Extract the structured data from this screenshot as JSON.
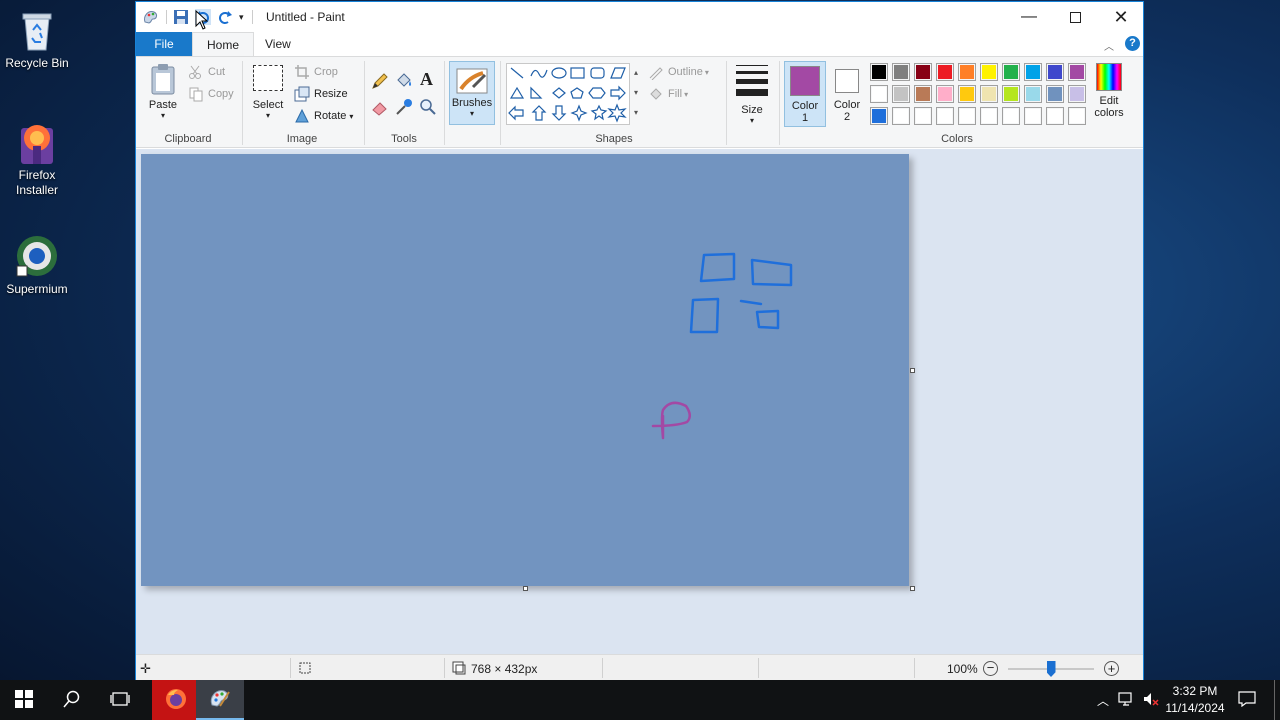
{
  "desktop": {
    "icons": [
      {
        "label": "Recycle Bin",
        "icon": "recycle-bin-icon"
      },
      {
        "label": "Firefox Installer",
        "icon": "firefox-installer-icon"
      },
      {
        "label": "Supermium",
        "icon": "supermium-icon"
      }
    ]
  },
  "window": {
    "title": "Untitled - Paint",
    "tabs": [
      {
        "label": "File"
      },
      {
        "label": "Home"
      },
      {
        "label": "View"
      }
    ],
    "ribbon": {
      "clipboard": {
        "group": "Clipboard",
        "paste": "Paste",
        "cut": "Cut",
        "copy": "Copy"
      },
      "image": {
        "group": "Image",
        "select": "Select",
        "crop": "Crop",
        "resize": "Resize",
        "rotate": "Rotate"
      },
      "tools": {
        "group": "Tools"
      },
      "brushes": {
        "label": "Brushes"
      },
      "shapes": {
        "group": "Shapes",
        "outline": "Outline",
        "fill": "Fill"
      },
      "size": {
        "label": "Size"
      },
      "colors": {
        "group": "Colors",
        "color1_label": "Color",
        "color1_num": "1",
        "color2_label": "Color",
        "color2_num": "2",
        "edit_line1": "Edit",
        "edit_line2": "colors",
        "color1": "#a349a4",
        "color2": "#ffffff",
        "palette_row1": [
          "#000000",
          "#7f7f7f",
          "#880015",
          "#ed1c24",
          "#ff7f27",
          "#fff200",
          "#22b14c",
          "#00a2e8",
          "#3f48cc",
          "#a349a4"
        ],
        "palette_row2": [
          "#ffffff",
          "#c3c3c3",
          "#b97a57",
          "#ffaec9",
          "#ffc90e",
          "#efe4b0",
          "#b5e61d",
          "#99d9ea",
          "#7092be",
          "#c8bfe7"
        ],
        "palette_row3": [
          "#1f6fdb",
          "#ffffff",
          "#ffffff",
          "#ffffff",
          "#ffffff",
          "#ffffff",
          "#ffffff",
          "#ffffff",
          "#ffffff",
          "#ffffff"
        ]
      }
    },
    "canvas": {
      "background": "#7294c0",
      "stroke_blue": "#1f6fdb",
      "stroke_purple": "#a349a4"
    },
    "status": {
      "dimensions": "768 × 432px",
      "zoom": "100%",
      "zoom_level": 1.0
    }
  },
  "taskbar": {
    "time": "3:32 PM",
    "date": "11/14/2024"
  }
}
